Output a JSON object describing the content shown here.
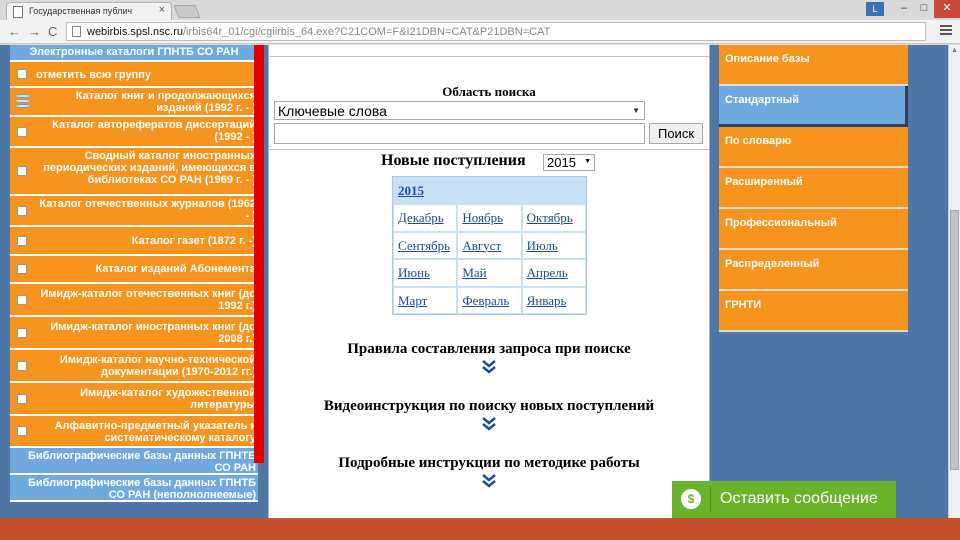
{
  "browser": {
    "tab_title": "Государственная публич",
    "tab_close": "×",
    "user_badge": "L",
    "url_host": "webirbis.spsl.nsc.ru",
    "url_path": "/irbis64r_01/cgi/cgiirbis_64.exe?C21COM=F&I21DBN=CAT&P21DBN=CAT",
    "btn_min": "–",
    "btn_max": "□",
    "btn_close": "✕",
    "back": "←",
    "forward": "→",
    "reload": "C"
  },
  "sidebar": {
    "header": "Электронные каталоги ГПНТБ СО РАН",
    "items": [
      {
        "label": "отметить всю группу"
      },
      {
        "label": "Каталог книг и продолжающихся изданий (1992 г. - )"
      },
      {
        "label": "Каталог авторефератов диссертаций (1992 - )"
      },
      {
        "label": "Сводный каталог иностранных периодических изданий, имеющихся в библиотеках СО РАН (1969 г. - )"
      },
      {
        "label": "Каталог отечественных журналов (1962 - )"
      },
      {
        "label": "Каталог газет (1872 г. -)"
      },
      {
        "label": "Каталог изданий Абонемента"
      },
      {
        "label": "Имидж-каталог отечественных книг (до 1992 г.)"
      },
      {
        "label": "Имидж-каталог иностранных книг (до 2008 г.)"
      },
      {
        "label": "Имидж-каталог научно-технической документации (1970-2012 гг.)"
      },
      {
        "label": "Имидж-каталог художественной литературы"
      },
      {
        "label": "Алфавитно-предметный указатель к систематическому каталогу"
      }
    ],
    "bottom": [
      {
        "label": "Библиографические базы данных ГПНТБ СО РАН"
      },
      {
        "label": "Библиографические базы данных ГПНТБ СО РАН (неполнолнеемые)"
      }
    ]
  },
  "search": {
    "area_label": "Область поиска",
    "area_value": "Ключевые слова",
    "input_value": "",
    "button": "Поиск",
    "new_label": "Новые поступления",
    "year": "2015"
  },
  "months": {
    "year_link": "2015",
    "rows": [
      [
        "Декабрь",
        "Ноябрь",
        "Октябрь"
      ],
      [
        "Сентябрь",
        "Август",
        "Июль"
      ],
      [
        "Июнь",
        "Май",
        "Апрель"
      ],
      [
        "Март",
        "Февраль",
        "Январь"
      ]
    ]
  },
  "sections": {
    "rules": "Правила составления запроса при поиске",
    "video": "Видеоинструкция по поиску новых поступлений",
    "detailed": "Подробные инструкции по методике работы"
  },
  "right_menu": {
    "items": [
      {
        "label": "Описание базы",
        "active": false
      },
      {
        "label": "Стандартный",
        "active": true
      },
      {
        "label": "По словарю",
        "active": false
      },
      {
        "label": "Расширенный",
        "active": false
      },
      {
        "label": "Профессиональный",
        "active": false
      },
      {
        "label": "Распределенный",
        "active": false
      },
      {
        "label": "ГРНТИ",
        "active": false
      }
    ]
  },
  "chat": {
    "label": "Оставить сообщение",
    "icon": "$"
  },
  "colors": {
    "orange": "#f7941e",
    "blue_light": "#70a9e0",
    "page_blue": "#5076a6",
    "red": "#e00000",
    "chat_green": "#6cb32c"
  }
}
